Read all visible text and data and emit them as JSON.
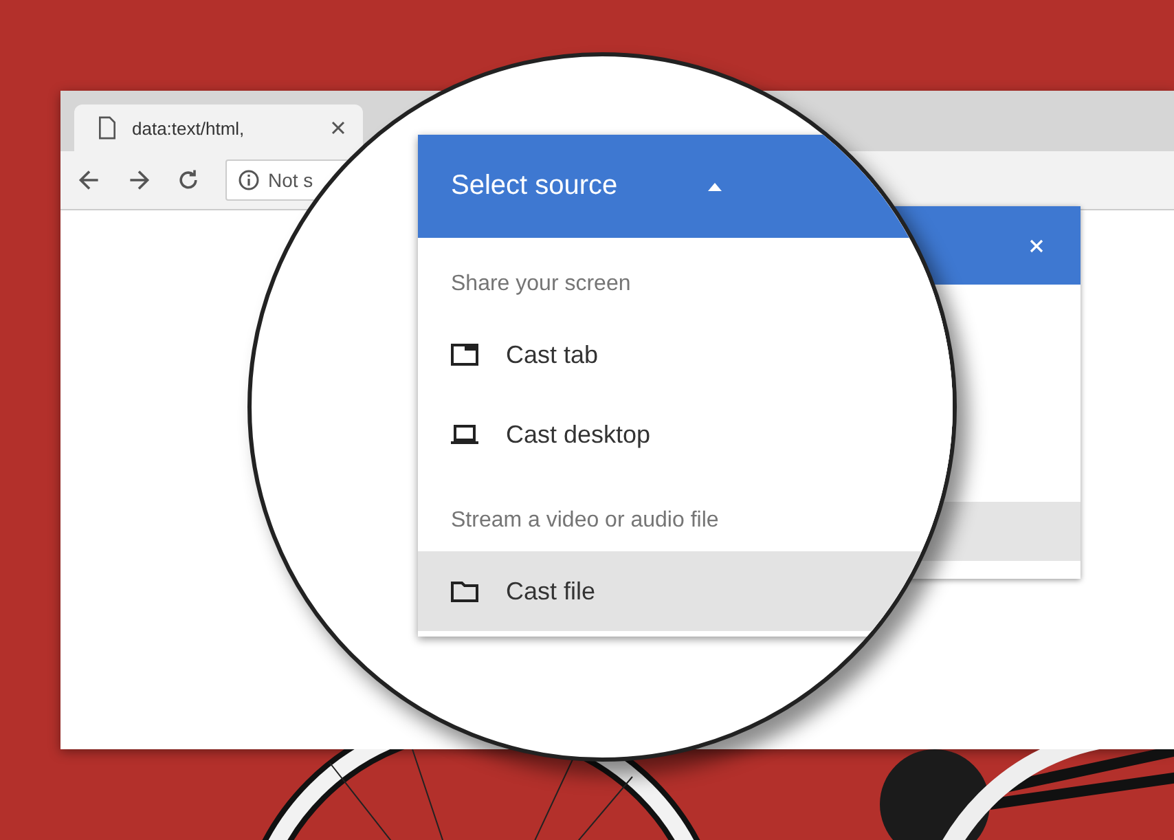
{
  "browser": {
    "tab": {
      "title": "data:text/html,"
    },
    "omnibox": {
      "security_text": "Not s"
    }
  },
  "magnifier": {
    "header": {
      "title": "Select source",
      "expanded": true
    },
    "sections": [
      {
        "heading": "Share your screen",
        "items": [
          {
            "label": "Cast tab",
            "kind": "tab",
            "selected": false
          },
          {
            "label": "Cast desktop",
            "kind": "desktop",
            "selected": false
          }
        ]
      },
      {
        "heading": "Stream a video or audio file",
        "items": [
          {
            "label": "Cast file",
            "kind": "file",
            "selected": true
          }
        ]
      }
    ]
  }
}
